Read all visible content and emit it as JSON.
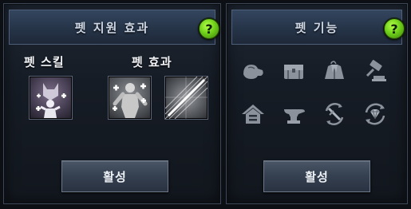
{
  "left_panel": {
    "title": "펫 지원 효과",
    "help_label": "?",
    "skill_label": "펫 스킬",
    "effect_label": "펫 효과",
    "activate_label": "활성"
  },
  "right_panel": {
    "title": "펫 기능",
    "help_label": "?",
    "activate_label": "활성",
    "function_icons": [
      "hat-icon",
      "chest-icon",
      "armor-icon",
      "gavel-icon",
      "home-icon",
      "anvil-icon",
      "sword-cycle-icon",
      "gem-cycle-icon"
    ]
  },
  "colors": {
    "help_button": "#6fd01a",
    "panel_border": "#3d4756",
    "icon_gray": "#8b929c"
  }
}
